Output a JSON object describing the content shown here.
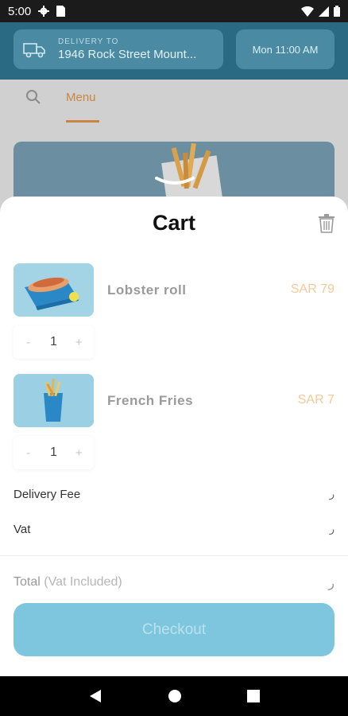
{
  "status_bar": {
    "time": "5:00"
  },
  "header": {
    "delivery_label": "DELIVERY TO",
    "delivery_address": "1946 Rock Street Mount...",
    "delivery_time": "Mon 11:00 AM"
  },
  "tabs": {
    "menu_label": "Menu"
  },
  "cart": {
    "title": "Cart",
    "items": [
      {
        "name": "Lobster roll",
        "price": "SAR 79",
        "quantity": "1",
        "minus": "-",
        "plus": "+"
      },
      {
        "name": "French Fries",
        "price": "SAR 7",
        "quantity": "1",
        "minus": "-",
        "plus": "+"
      }
    ],
    "delivery_fee_label": "Delivery Fee",
    "delivery_fee_value": "ﺭ",
    "vat_label": "Vat",
    "vat_value": "ﺭ",
    "total_label": "Total",
    "total_note": "(Vat Included)",
    "total_value": "ﺭ",
    "checkout_label": "Checkout"
  },
  "colors": {
    "header": "#2a6b83",
    "accent": "#c98640",
    "checkout": "#7ec6dd"
  }
}
